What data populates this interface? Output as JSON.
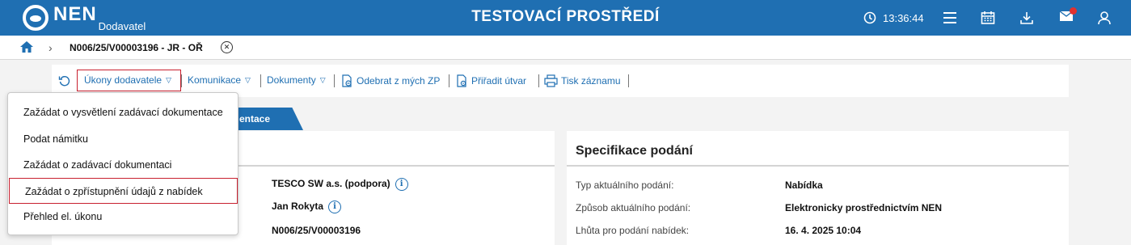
{
  "header": {
    "logo_text": "NEN",
    "logo_sub": "Dodavatel",
    "environment": "TESTOVACÍ PROSTŘEDÍ",
    "time": "13:36:44"
  },
  "breadcrumb": {
    "record": "N006/25/V00003196 - JR - OŘ"
  },
  "toolbar": {
    "ukony": "Úkony dodavatele",
    "komunikace": "Komunikace",
    "dokumenty": "Dokumenty",
    "odebrat": "Odebrat z mých ZP",
    "priradit": "Přiřadit útvar",
    "tisk": "Tisk záznamu"
  },
  "tab": {
    "label": "entace"
  },
  "dropdown": {
    "items": [
      "Zažádat o vysvětlení zadávací dokumentace",
      "Podat námitku",
      "Zažádat o zadávací dokumentaci",
      "Zažádat o zpřístupnění údajů z nabídek",
      "Přehled el. úkonu"
    ]
  },
  "left_panel": {
    "values": [
      "TESCO SW a.s. (podpora)",
      "Jan Rokyta",
      "N006/25/V00003196"
    ]
  },
  "right_panel": {
    "title": "Specifikace podání",
    "rows": [
      {
        "label": "Typ aktuálního podání:",
        "value": "Nabídka"
      },
      {
        "label": "Způsob aktuálního podání:",
        "value": "Elektronicky prostřednictvím NEN"
      },
      {
        "label": "Lhůta pro podání nabídek:",
        "value": "16. 4. 2025 10:04"
      }
    ]
  },
  "colors": {
    "brand": "#1f6fb2",
    "highlight": "#c8202f",
    "badge": "#e0312f"
  }
}
